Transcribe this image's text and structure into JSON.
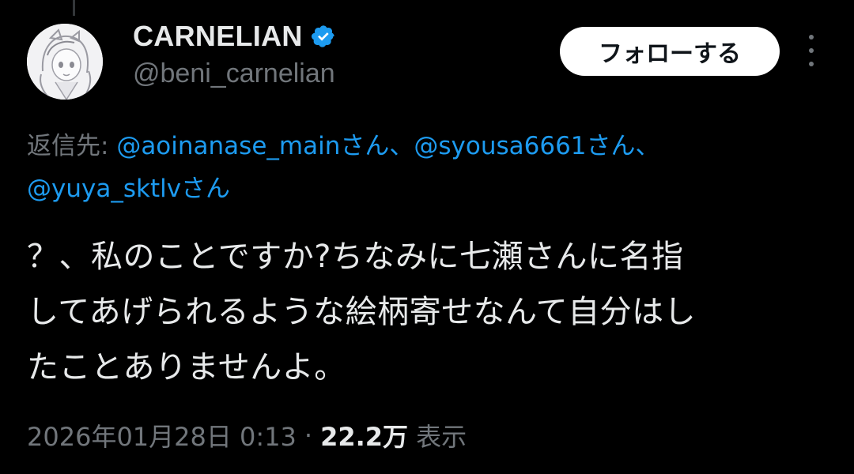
{
  "tweet": {
    "author": {
      "display_name": "CARNELIAN",
      "handle": "@beni_carnelian",
      "verified": true
    },
    "follow_label": "フォローする",
    "reply_to": {
      "prefix": "返信先:",
      "mentions": [
        "@aoinanase_mainさん",
        "@syousa6661さん",
        "@yuya_sktlvさん"
      ],
      "separator": "、"
    },
    "text_lines": [
      "？、私のことですか?ちなみに七瀬さんに名指",
      "してあげられるような絵柄寄せなんて自分はし",
      "たことありませんよ。"
    ],
    "timestamp": "2026年01月28日 0:13",
    "dot": "·",
    "views_count": "22.2万",
    "views_label": "表示"
  },
  "colors": {
    "background": "#000000",
    "text": "#e7e9ea",
    "muted": "#71767b",
    "accent": "#1d9bf0"
  },
  "icons": {
    "verified": "verified-badge-icon",
    "more": "more-vertical-icon"
  }
}
